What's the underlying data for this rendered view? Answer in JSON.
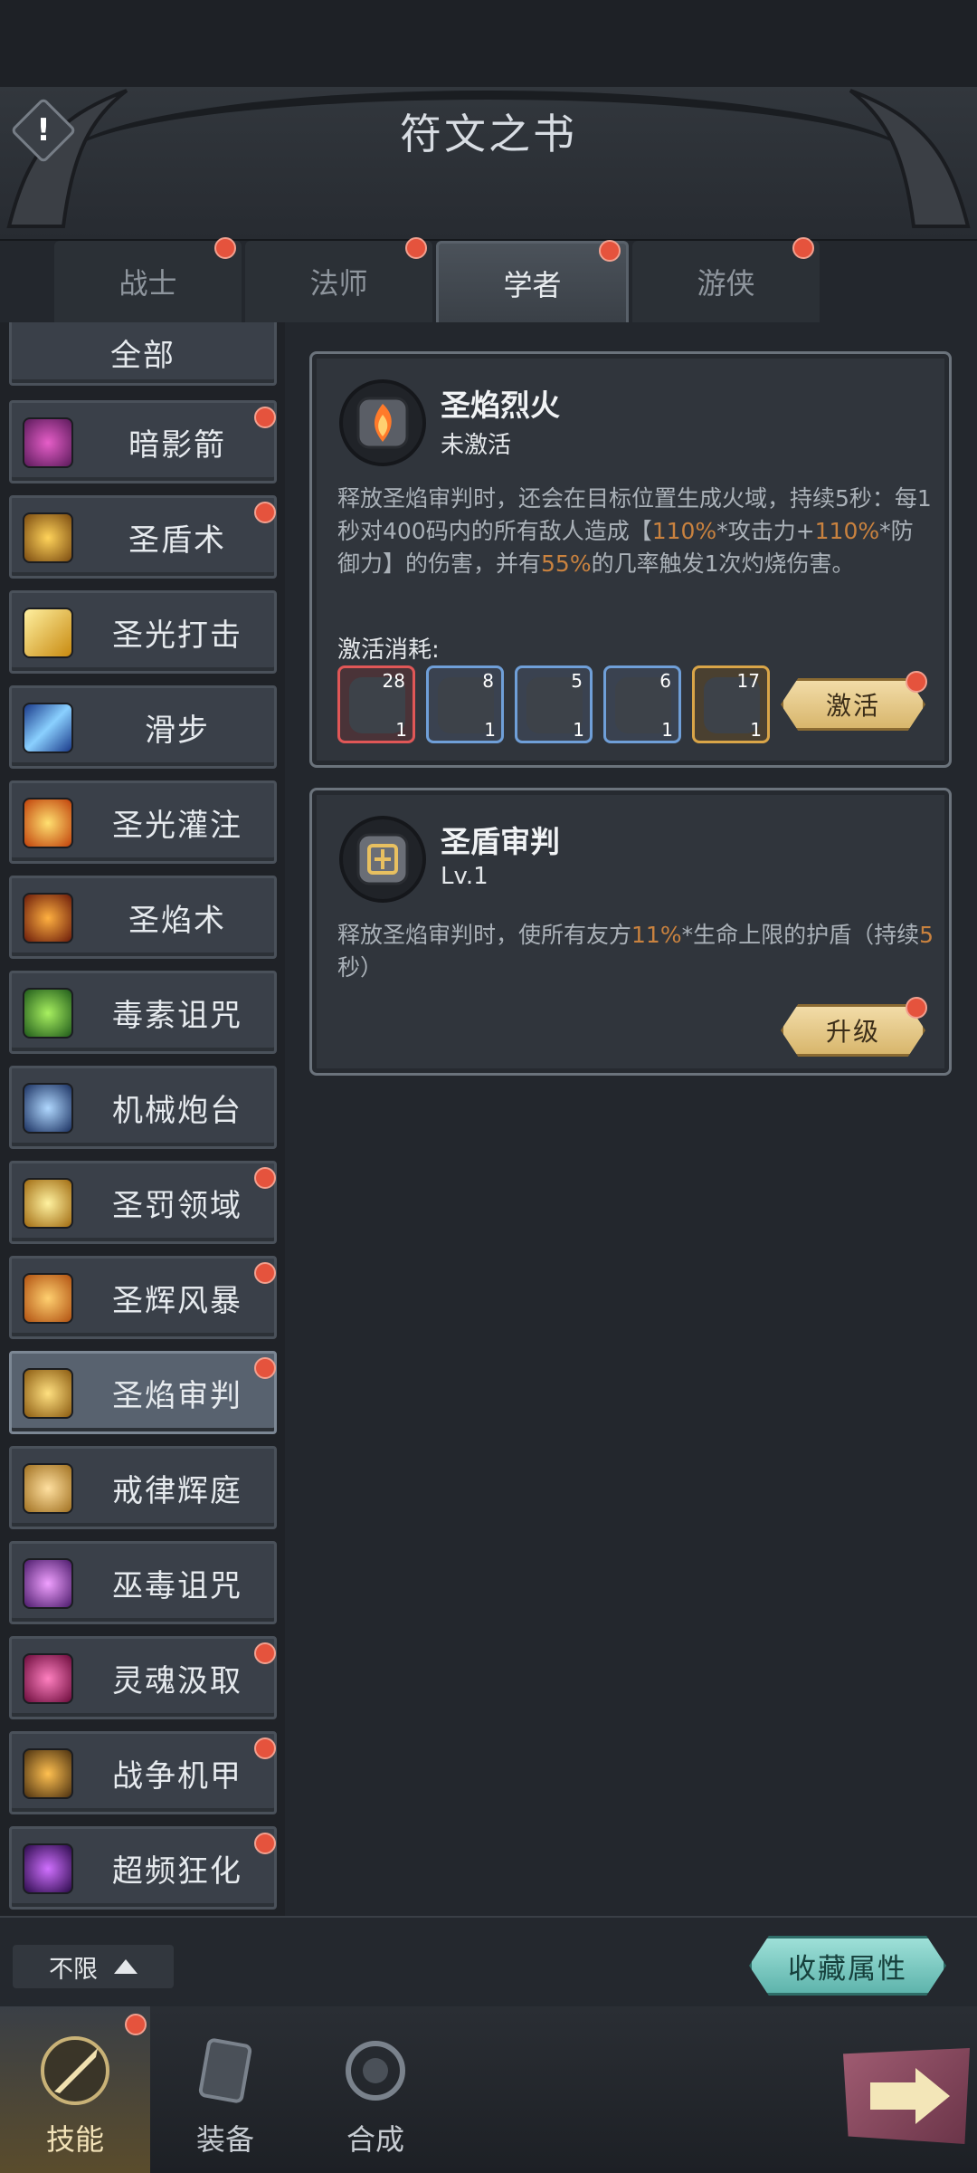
{
  "header": {
    "title": "符文之书",
    "alert_icon": "!"
  },
  "tabs": [
    {
      "label": "战士",
      "active": false,
      "badge": true
    },
    {
      "label": "法师",
      "active": false,
      "badge": true
    },
    {
      "label": "学者",
      "active": true,
      "badge": true
    },
    {
      "label": "游侠",
      "active": false,
      "badge": true
    }
  ],
  "sidebar": {
    "all_label": "全部",
    "items": [
      {
        "label": "暗影箭",
        "icon": "shadow-arrow-icon",
        "badge": true
      },
      {
        "label": "圣盾术",
        "icon": "holy-shield-icon",
        "badge": true
      },
      {
        "label": "圣光打击",
        "icon": "holy-strike-icon",
        "badge": false
      },
      {
        "label": "滑步",
        "icon": "slide-step-icon",
        "badge": false
      },
      {
        "label": "圣光灌注",
        "icon": "holy-infusion-icon",
        "badge": false
      },
      {
        "label": "圣焰术",
        "icon": "holy-flame-icon",
        "badge": false
      },
      {
        "label": "毒素诅咒",
        "icon": "toxin-curse-icon",
        "badge": false
      },
      {
        "label": "机械炮台",
        "icon": "mech-turret-icon",
        "badge": false
      },
      {
        "label": "圣罚领域",
        "icon": "holy-punish-field-icon",
        "badge": true
      },
      {
        "label": "圣辉风暴",
        "icon": "holy-storm-icon",
        "badge": true
      },
      {
        "label": "圣焰审判",
        "icon": "holy-flame-judgment-icon",
        "badge": true,
        "active": true
      },
      {
        "label": "戒律辉庭",
        "icon": "discipline-court-icon",
        "badge": false
      },
      {
        "label": "巫毒诅咒",
        "icon": "voodoo-curse-icon",
        "badge": false
      },
      {
        "label": "灵魂汲取",
        "icon": "soul-drain-icon",
        "badge": true
      },
      {
        "label": "战争机甲",
        "icon": "war-mech-icon",
        "badge": true
      },
      {
        "label": "超频狂化",
        "icon": "overclock-frenzy-icon",
        "badge": true
      }
    ]
  },
  "card1": {
    "name": "圣焰烈火",
    "status": "未激活",
    "desc_a": "释放圣焰审判时，还会在目标位置生成火域，持续5秒：每1秒对400码内的所有敌人造成【",
    "desc_hl1": "110%",
    "desc_b": "*攻击力+",
    "desc_hl2": "110%",
    "desc_c": "*防御力】的伤害，并有",
    "desc_hl3": "55%",
    "desc_d": "的几率触发1次灼烧伤害。",
    "cost_label": "激活消耗:",
    "costs": [
      {
        "owned": "28",
        "need": "1",
        "rarity": "red"
      },
      {
        "owned": "8",
        "need": "1",
        "rarity": "blue"
      },
      {
        "owned": "5",
        "need": "1",
        "rarity": "blue"
      },
      {
        "owned": "6",
        "need": "1",
        "rarity": "blue"
      },
      {
        "owned": "17",
        "need": "1",
        "rarity": "gold"
      }
    ],
    "button": "激活"
  },
  "card2": {
    "name": "圣盾审判",
    "level": "Lv.1",
    "desc_a": "释放圣焰审判时，使所有友方",
    "desc_hl1": "11%",
    "desc_b": "*生命上限的护盾（持续",
    "desc_hl2": "5",
    "desc_c": "秒）",
    "button": "升级"
  },
  "bottom": {
    "filter": "不限",
    "collect": "收藏属性"
  },
  "nav": [
    {
      "label": "技能",
      "icon": "sword-icon",
      "active": true,
      "badge": true
    },
    {
      "label": "装备",
      "icon": "equipment-icon",
      "active": false,
      "badge": false
    },
    {
      "label": "合成",
      "icon": "synthesis-icon",
      "active": false,
      "badge": false
    }
  ],
  "colors": {
    "accent_orange": "#c9823f",
    "badge_red": "#e5533d",
    "gold_button": "#e8cc8a",
    "teal_button": "#7ccac2"
  }
}
